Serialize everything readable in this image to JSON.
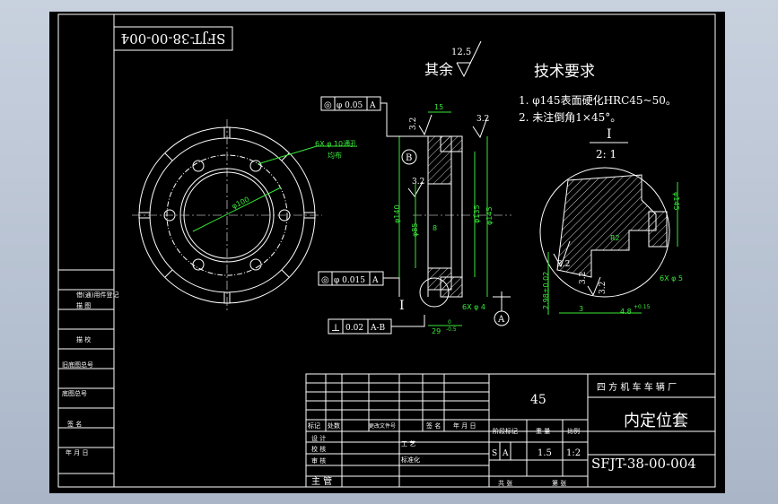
{
  "drawing_number": "SFJT-38-00-004",
  "drawing_number_mirrored": "SFJT-38-00-004",
  "surface_finish": {
    "rest_label": "其余",
    "rest_value": "12.5",
    "value_32": "3.2"
  },
  "tech_requirements": {
    "title": "技术要求",
    "items": [
      "1. φ145表面硬化HRC45~50。",
      "2. 未注倒角1×45°。"
    ]
  },
  "detail_view": {
    "label": "I",
    "scale": "2: 1"
  },
  "front_view": {
    "holes_note_1": "6X φ 10通孔",
    "holes_note_2": "均布",
    "pcd": "φ100"
  },
  "side_view": {
    "width_dim": "15",
    "dia_140": "φ140",
    "dia_85": "φ85",
    "dia_135": "φ135",
    "dia_145": "φ145",
    "small_8": "8",
    "thread_note": "6X φ 4",
    "length_dim": "29",
    "length_tol": "-0.5",
    "length_tol_up": "0",
    "datum_b": "B",
    "datum_a": "A",
    "section_mark": "I"
  },
  "tolerances": {
    "fcf1_value": "φ 0.05",
    "fcf1_datum": "A",
    "fcf2_value": "φ 0.015",
    "fcf2_datum": "A",
    "fcf3_symbol": "⊥",
    "fcf3_value": "0.02",
    "fcf3_datum": "A-B",
    "concentric_symbol": "◎"
  },
  "detail_dims": {
    "d145": "φ145",
    "r": "R2",
    "h": "2.98±0.02",
    "w3": "3",
    "w48": "4.8",
    "w48_tol": "+0.15",
    "thread": "6X φ 5",
    "r32a": "3.2",
    "r32b": "3.2",
    "r32c": "3.2"
  },
  "title_block": {
    "material": "45",
    "company": "四 方 机 车 车 辆 厂",
    "part_name": "内定位套",
    "drawing_no": "SFJT-38-00-004",
    "scale_header": "比例",
    "weight_header": "重 量",
    "mark_header": "阶段标记",
    "scale_value": "1:2",
    "weight_value": "1.5",
    "stage_s": "S",
    "stage_a": "A",
    "sheet_total": "共 张",
    "sheet_no": "第 张",
    "rev_headers": [
      "标记",
      "处数",
      "更改文件号",
      "签 名",
      "年 月 日"
    ],
    "sign_rows": [
      "设 计",
      "校 核",
      "审 核",
      "主 管"
    ],
    "sign_right": [
      "工 艺",
      "标准化"
    ]
  },
  "side_labels": [
    "借(通)用件登记",
    "描 图",
    "描 校",
    "旧底图总号",
    "底图总号",
    "签 名",
    "年 月 日"
  ],
  "colors": {
    "background": "#000000",
    "line": "#ffffff",
    "dimension": "#37e837",
    "frame": "#b9c4d4"
  }
}
